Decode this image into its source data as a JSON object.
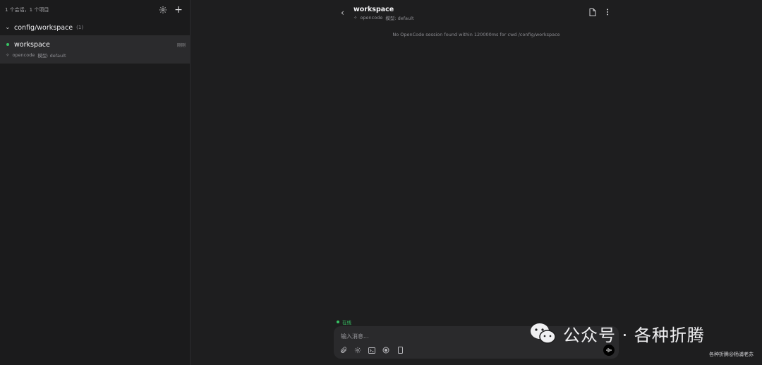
{
  "sidebar": {
    "summary": "1 个会话，1 个项目",
    "group": {
      "name": "config/workspace",
      "count": "(1)"
    },
    "session": {
      "title": "workspace",
      "time": "刚刚",
      "agent": "opencode",
      "model": "模型: default"
    }
  },
  "main": {
    "title": "workspace",
    "agent": "opencode",
    "model": "模型: default",
    "notice": "No OpenCode session found within 120000ms for cwd /config/workspace",
    "status": "在线",
    "input_placeholder": "输入消息..."
  },
  "watermark": {
    "text": "公众号 · 各种折腾",
    "small": "各种折腾@杨浦老苏"
  },
  "colors": {
    "online": "#37c464",
    "background": "#1e1e1f",
    "sidebar": "#1b1b1c",
    "selected": "#2b2b2d"
  },
  "icons": [
    "settings-icon",
    "plus-icon",
    "chevron-down-icon",
    "sparkle-icon",
    "chevron-left-icon",
    "document-icon",
    "more-vertical-icon",
    "paperclip-icon",
    "gear-icon",
    "terminal-icon",
    "record-icon",
    "phone-icon",
    "voice-icon",
    "wechat-icon"
  ]
}
